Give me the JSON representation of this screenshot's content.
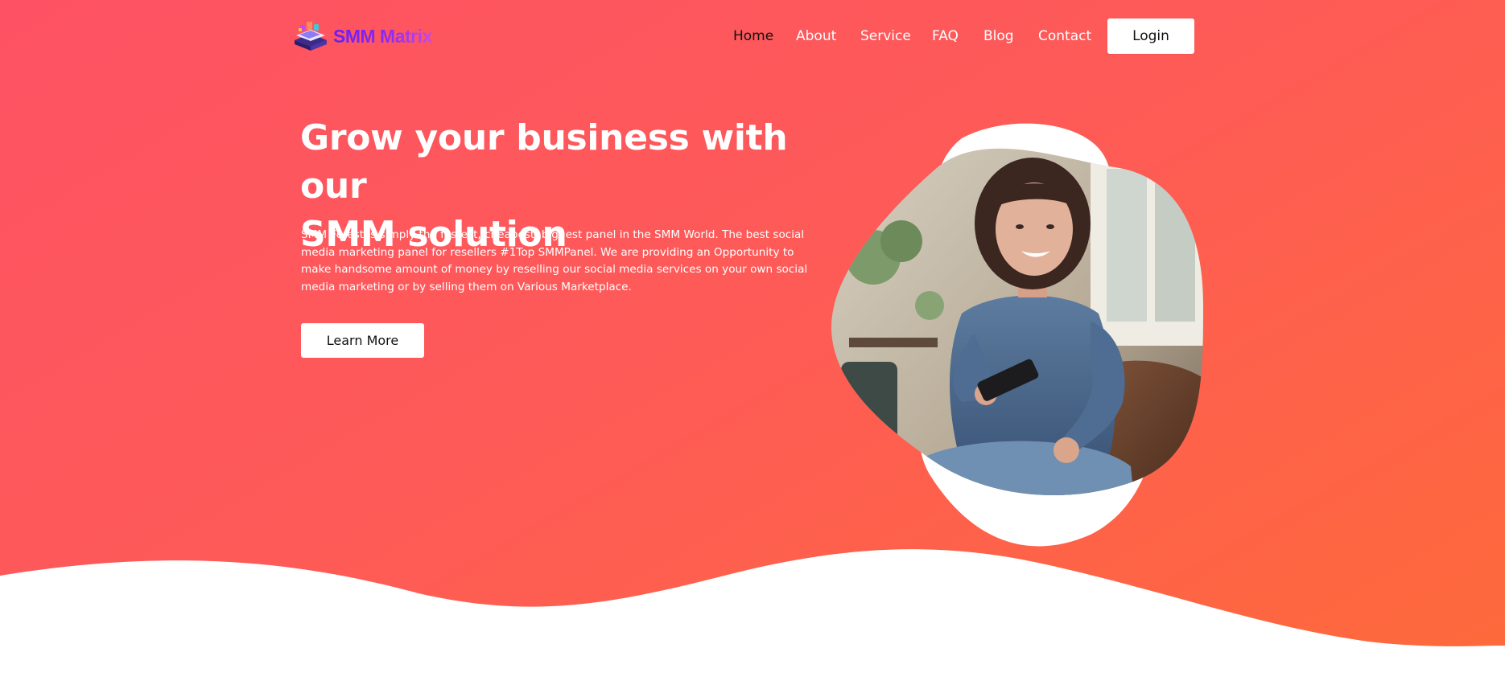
{
  "brand": {
    "name": "SMM Matrix",
    "logo_icon": "stacked-devices-icon"
  },
  "nav": {
    "items": [
      {
        "label": "Home",
        "active": true
      },
      {
        "label": "About",
        "active": false
      },
      {
        "label": "Service",
        "active": false
      },
      {
        "label": "FAQ",
        "active": false
      },
      {
        "label": "Blog",
        "active": false
      },
      {
        "label": "Contact",
        "active": false
      }
    ],
    "login_label": "Login"
  },
  "hero": {
    "headline_line1": "Grow your business with our",
    "headline_line2": "SMM solution",
    "description": "SMM Forest is simply the fastest, cheapest, biggest panel in the SMM World. The best social media marketing panel for resellers #1Top SMMPanel. We are providing an Opportunity to make handsome amount of money by reselling our social media services on your own social media marketing or by selling them on Various Marketplace.",
    "cta_label": "Learn More"
  },
  "colors": {
    "gradient_start": "#fe5264",
    "gradient_end": "#fe6a3a",
    "logo_gradient_start": "#6b1cf5",
    "logo_gradient_end": "#c64ae9",
    "active_nav": "#111111"
  }
}
